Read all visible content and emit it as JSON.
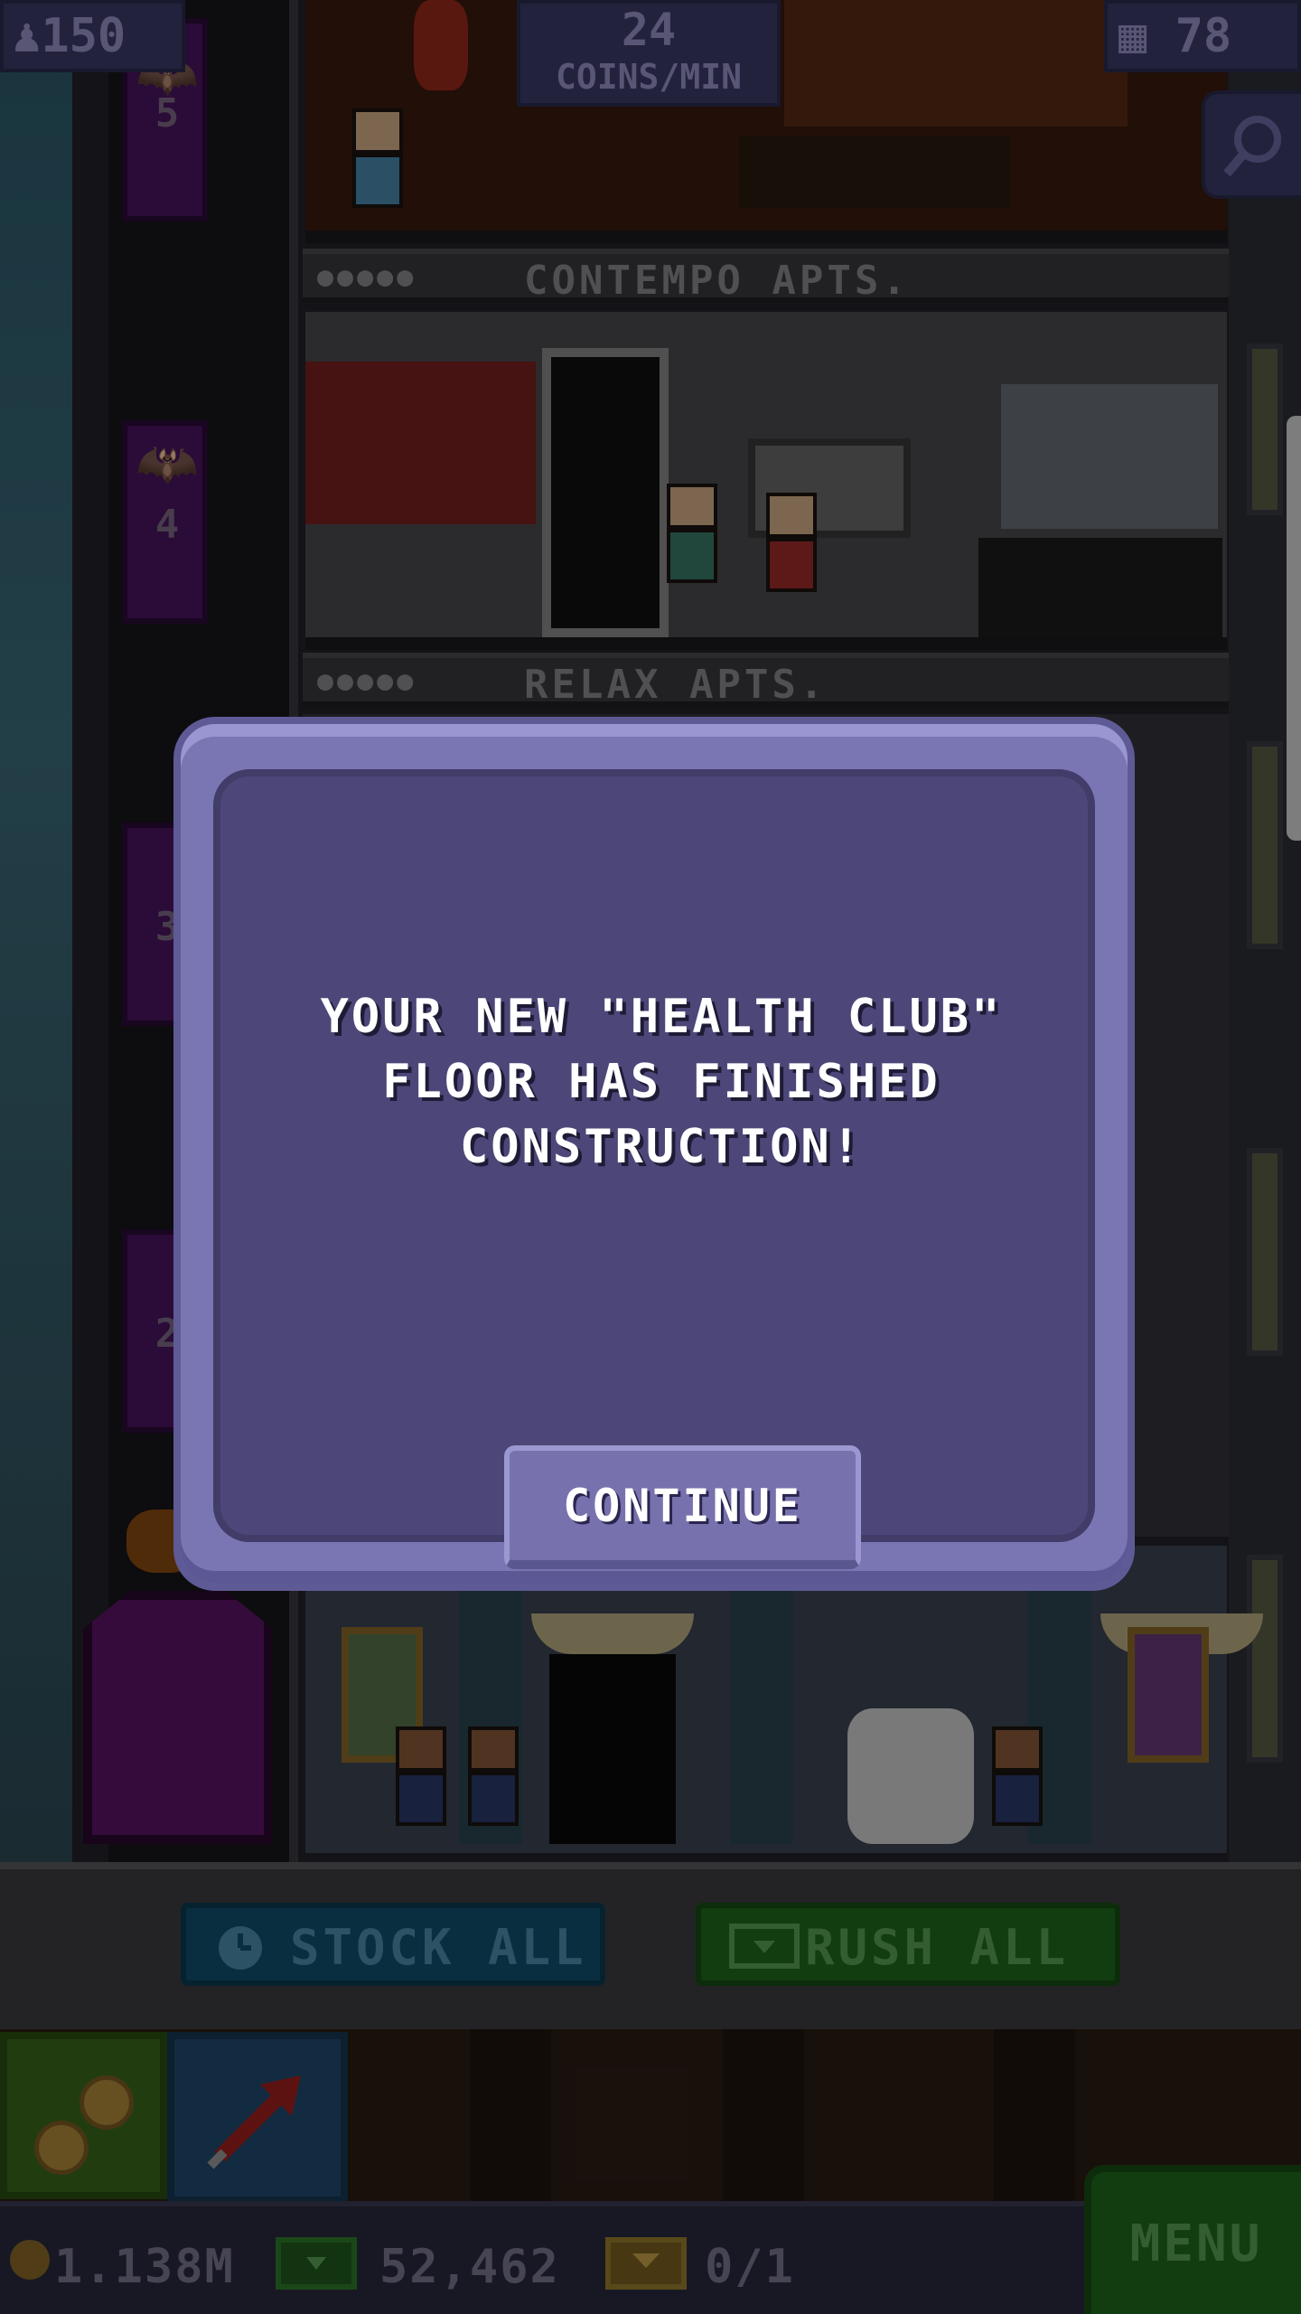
{
  "hud": {
    "population": "150",
    "income_rate": "24",
    "income_unit": "COINS/MIN",
    "floor_count": "78"
  },
  "floors": {
    "elevator_numbers": [
      "5",
      "4",
      "3",
      "2"
    ],
    "signs": [
      {
        "name": "CONTEMPO APTS.",
        "residents": "●●●●●"
      },
      {
        "name": "RELAX APTS.",
        "residents": "●●●●●"
      }
    ]
  },
  "actions": {
    "stock_all": "STOCK ALL",
    "rush_all": "RUSH ALL"
  },
  "currency": {
    "coins": "1.138M",
    "bux": "52,462",
    "tickets": "0/1"
  },
  "menu_label": "MENU",
  "dialog": {
    "message_line1": "YOUR NEW \"HEALTH CLUB\"",
    "message_line2": "FLOOR HAS FINISHED",
    "message_line3": "CONSTRUCTION!",
    "continue_label": "CONTINUE"
  },
  "colors": {
    "dialog_outer": "#7a76b4",
    "dialog_inner": "#4c4778",
    "stock_button": "#10506e",
    "rush_button": "#1f6a1c",
    "hud_panel": "#3c3b6a"
  },
  "icons": {
    "population": "person-icon",
    "floors": "building-icon",
    "search": "magnifier-icon",
    "stock": "clock-icon",
    "rush": "bux-icon",
    "coins": "coin-icon",
    "build": "arrow-up-right-icon",
    "tickets": "ticket-icon"
  }
}
